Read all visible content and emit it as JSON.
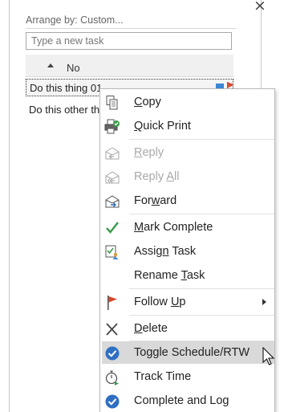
{
  "pane": {
    "close_glyph": "×",
    "arrange_label": "Arrange by: Custom...",
    "new_task_placeholder": "Type a new task",
    "group_label": "No",
    "tasks": [
      {
        "title": "Do this thing 01"
      },
      {
        "title": "Do this other thing"
      }
    ]
  },
  "colors": {
    "category_blue": "#3a87d6",
    "flag_red": "#d9472b",
    "check_blue": "#2f6fc2",
    "check_green": "#3a9a4a",
    "highlight": "#d9d9d9"
  },
  "menu": {
    "items": [
      {
        "pre": "",
        "key": "C",
        "post": "opy",
        "icon": "copy-icon",
        "enabled": true
      },
      {
        "pre": "",
        "key": "Q",
        "post": "uick Print",
        "icon": "quick-print-icon",
        "enabled": true
      },
      {
        "pre": "",
        "key": "R",
        "post": "eply",
        "icon": "reply-icon",
        "enabled": false
      },
      {
        "pre": "Reply ",
        "key": "A",
        "post": "ll",
        "icon": "reply-all-icon",
        "enabled": false
      },
      {
        "pre": "For",
        "key": "w",
        "post": "ard",
        "icon": "forward-icon",
        "enabled": true
      },
      {
        "pre": "",
        "key": "M",
        "post": "ark Complete",
        "icon": "checkmark-icon",
        "enabled": true
      },
      {
        "pre": "Assig",
        "key": "n",
        "post": " Task",
        "icon": "assign-task-icon",
        "enabled": true
      },
      {
        "pre": "Rename ",
        "key": "T",
        "post": "ask",
        "icon": "",
        "enabled": true
      },
      {
        "pre": "Follow ",
        "key": "U",
        "post": "p",
        "icon": "flag-icon",
        "enabled": true,
        "submenu": true
      },
      {
        "pre": "",
        "key": "D",
        "post": "elete",
        "icon": "delete-icon",
        "enabled": true
      },
      {
        "pre": "Toggle Schedule/RTW",
        "key": "",
        "post": "",
        "icon": "check-circle-icon",
        "enabled": true,
        "highlighted": true
      },
      {
        "pre": "Track Time",
        "key": "",
        "post": "",
        "icon": "stopwatch-icon",
        "enabled": true
      },
      {
        "pre": "Complete and Log",
        "key": "",
        "post": "",
        "icon": "check-circle-icon",
        "enabled": true
      }
    ]
  }
}
